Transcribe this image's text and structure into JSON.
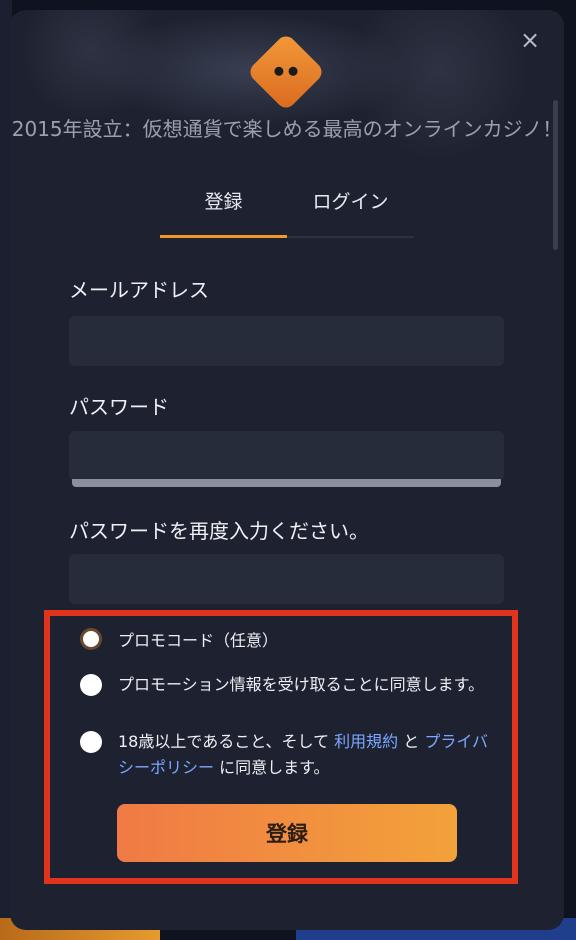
{
  "modal": {
    "close_icon": "×",
    "tagline": "2015年設立：仮想通貨で楽しめる最高のオンラインカジノ！",
    "tabs": [
      {
        "label": "登録",
        "active": true
      },
      {
        "label": "ログイン",
        "active": false
      }
    ],
    "fields": {
      "email": {
        "label": "メールアドレス",
        "value": "",
        "placeholder": ""
      },
      "password": {
        "label": "パスワード",
        "value": "",
        "placeholder": ""
      },
      "password_confirm": {
        "label": "パスワードを再度入力ください。",
        "value": "",
        "placeholder": ""
      }
    },
    "options": {
      "promo_code": "プロモコード（任意）",
      "promotions_consent": "プロモーション情報を受け取ることに同意します。",
      "age_terms_prefix": "18歳以上であること、そして ",
      "terms_link": "利用規約",
      "and": " と ",
      "privacy_link": "プライバシーポリシー",
      "age_terms_suffix": " に同意します。"
    },
    "submit_label": "登録",
    "colors": {
      "accent": "#f0982a",
      "link": "#7aa7ff",
      "highlight": "#e0341e"
    }
  }
}
